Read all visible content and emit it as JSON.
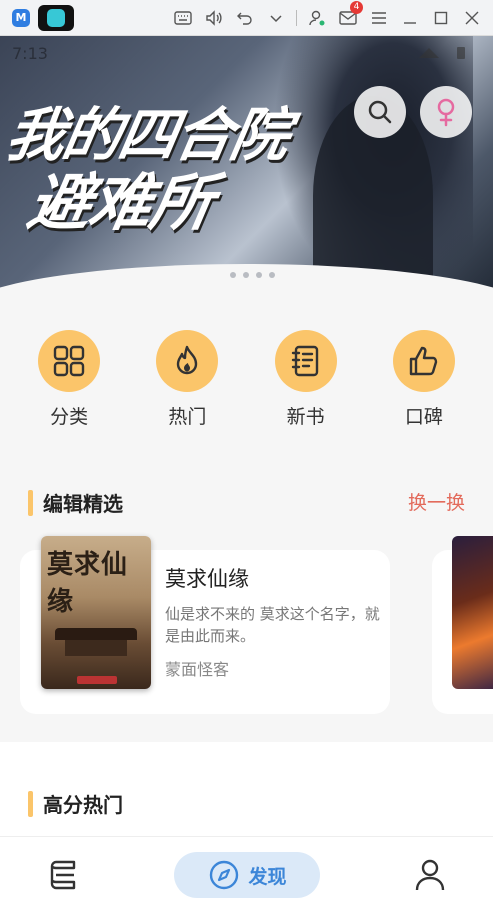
{
  "window": {
    "tabs": [
      {
        "name": "app-tab-m",
        "color": "#2f7de1"
      },
      {
        "name": "app-tab-game",
        "color": "#37c8d6"
      }
    ],
    "mail_badge": "4"
  },
  "status": {
    "time": "7:13"
  },
  "banner": {
    "title_line1": "我的四合院",
    "title_line2": "避难所",
    "dots_count": 4
  },
  "categories": [
    {
      "label": "分类",
      "icon": "grid-icon"
    },
    {
      "label": "热门",
      "icon": "flame-icon"
    },
    {
      "label": "新书",
      "icon": "notebook-icon"
    },
    {
      "label": "口碑",
      "icon": "thumbs-up-icon"
    }
  ],
  "editor_picks": {
    "title": "编辑精选",
    "refresh_label": "换一换",
    "book": {
      "cover_title": "莫求仙缘",
      "title": "莫求仙缘",
      "description": "仙是求不来的 莫求这个名字，就是由此而来。",
      "author": "蒙面怪客"
    }
  },
  "high_score": {
    "title": "高分热门"
  },
  "bottom_nav": {
    "active_label": "发现"
  },
  "colors": {
    "accent_yellow": "#fbc56a",
    "refresh_red": "#e36b5c",
    "nav_active_bg": "#dbe9f8",
    "nav_active_text": "#3c86d8"
  }
}
